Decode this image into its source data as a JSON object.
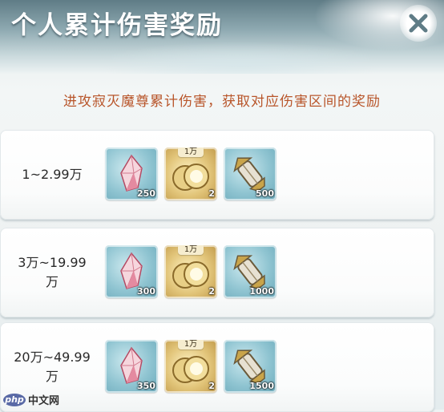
{
  "window": {
    "title": "个人累计伤害奖励"
  },
  "subtitle": "进攻寂灭魔尊累计伤害，获取对应伤害区间的奖励",
  "rows": [
    {
      "range": "1~2.99万",
      "items": [
        {
          "icon": "crystal-icon",
          "qty": "250"
        },
        {
          "icon": "coin-icon",
          "qty": "2",
          "tag": "1万"
        },
        {
          "icon": "lantern-icon",
          "qty": "500"
        }
      ]
    },
    {
      "range": "3万~19.99万",
      "items": [
        {
          "icon": "crystal-icon",
          "qty": "300"
        },
        {
          "icon": "coin-icon",
          "qty": "2",
          "tag": "1万"
        },
        {
          "icon": "lantern-icon",
          "qty": "1000"
        }
      ]
    },
    {
      "range": "20万~49.99万",
      "items": [
        {
          "icon": "crystal-icon",
          "qty": "350"
        },
        {
          "icon": "coin-icon",
          "qty": "2",
          "tag": "1万"
        },
        {
          "icon": "lantern-icon",
          "qty": "1500"
        }
      ]
    }
  ],
  "watermark": {
    "logo": "php",
    "text": "中文网"
  },
  "colors": {
    "subtitle": "#b8552a",
    "header_top": "#5f7c86",
    "item_blue": "#8fc4d1",
    "item_gold": "#e2c57a"
  }
}
